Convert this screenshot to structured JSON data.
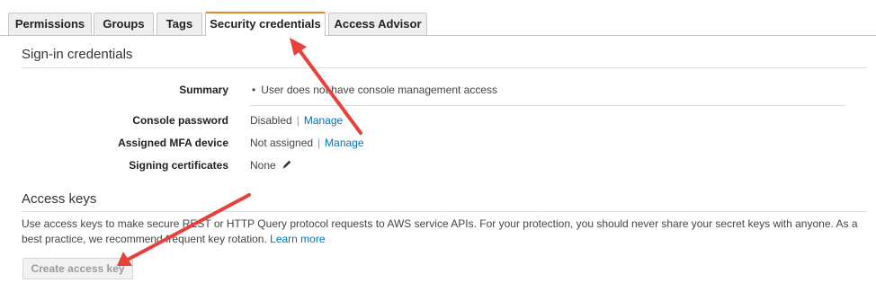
{
  "tabs": [
    {
      "label": "Permissions",
      "active": false
    },
    {
      "label": "Groups",
      "active": false
    },
    {
      "label": "Tags",
      "active": false
    },
    {
      "label": "Security credentials",
      "active": true
    },
    {
      "label": "Access Advisor",
      "active": false
    }
  ],
  "signin": {
    "title": "Sign-in credentials",
    "summary": {
      "label": "Summary",
      "bullet": "•",
      "value": "User does not have console management access"
    },
    "console_password": {
      "label": "Console password",
      "value": "Disabled",
      "separator": "|",
      "link": "Manage"
    },
    "mfa": {
      "label": "Assigned MFA device",
      "value": "Not assigned",
      "separator": "|",
      "link": "Manage"
    },
    "signing_certificates": {
      "label": "Signing certificates",
      "value": "None",
      "icon": "pencil-icon"
    }
  },
  "access_keys": {
    "title": "Access keys",
    "description": "Use access keys to make secure REST or HTTP Query protocol requests to AWS service APIs. For your protection, you should never share your secret keys with anyone. As a best practice, we recommend frequent key rotation.",
    "learn_more": "Learn more",
    "button": "Create access key",
    "button_disabled": true
  },
  "colors": {
    "active_tab_accent": "#e08a2b",
    "link": "#0073bb",
    "annotation_arrow": "#e8403b"
  }
}
